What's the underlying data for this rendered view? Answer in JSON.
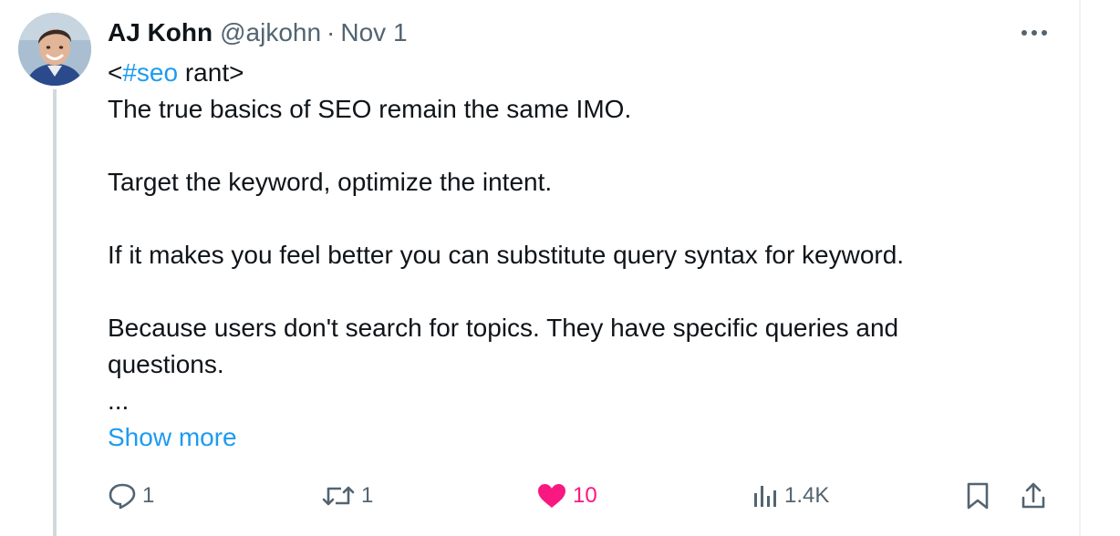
{
  "author": {
    "display_name": "AJ Kohn",
    "handle": "@ajkohn",
    "separator": "·",
    "date": "Nov 1"
  },
  "tweet": {
    "first_line_prefix": "<",
    "hashtag": "#seo",
    "first_line_suffix": " rant>",
    "lines": [
      "The true basics of SEO remain the same IMO.",
      "Target the keyword, optimize the intent.",
      "If it makes you feel better you can substitute query syntax for keyword.",
      "Because users don't search for topics. They have specific queries and",
      "questions.",
      "..."
    ],
    "show_more_label": "Show more"
  },
  "actions": {
    "replies": "1",
    "retweets": "1",
    "likes": "10",
    "views": "1.4K"
  },
  "icons": {
    "more": "more-horizontal-icon",
    "reply": "reply-icon",
    "retweet": "retweet-icon",
    "like": "heart-filled-icon",
    "views": "views-icon",
    "bookmark": "bookmark-icon",
    "share": "share-icon"
  },
  "colors": {
    "accent": "#1d9bf0",
    "like": "#f91880",
    "secondary_text": "#536471",
    "primary_text": "#0f1419",
    "thread_line": "#cfd9de"
  }
}
